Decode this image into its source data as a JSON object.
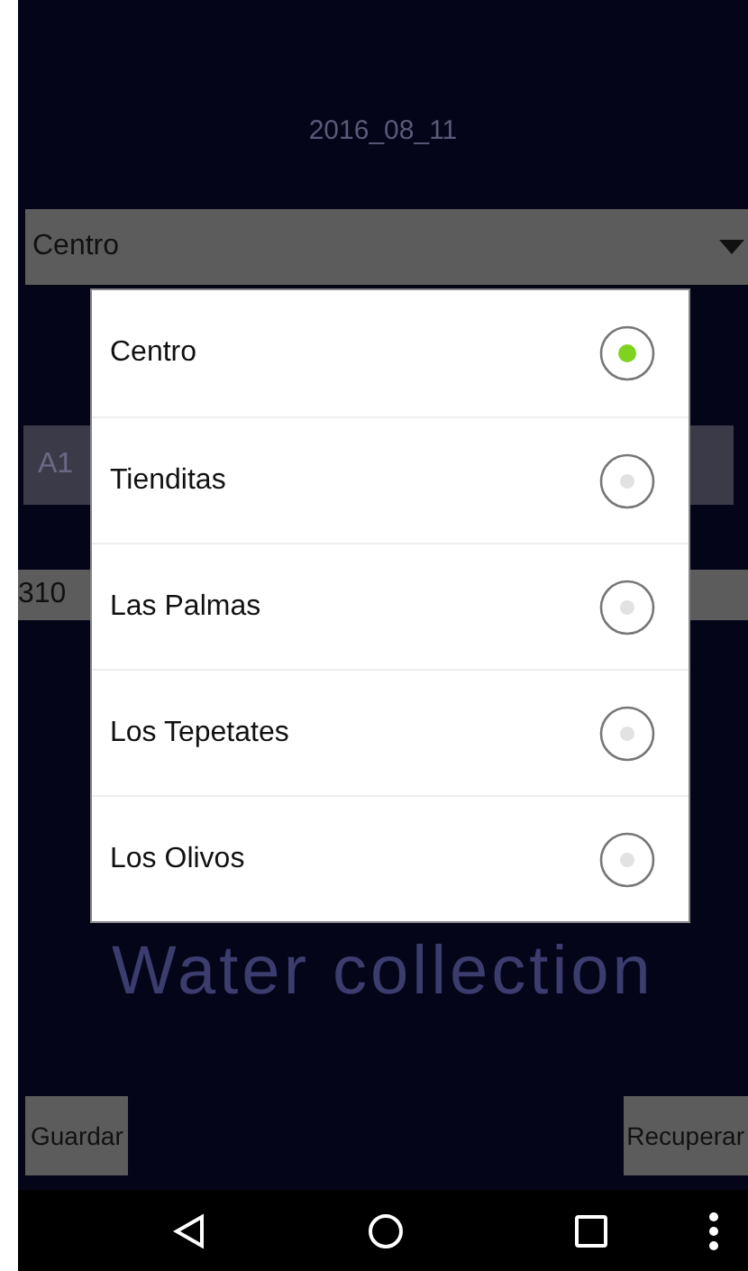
{
  "date": "2016_08_11",
  "spinner": {
    "value": "Centro"
  },
  "field_1": {
    "placeholder": "A1"
  },
  "field_2": {
    "value": "310"
  },
  "title": "Water collection",
  "buttons": [
    "Guardar",
    "Recuperar"
  ],
  "dialog": {
    "options": [
      {
        "label": "Centro",
        "selected": true
      },
      {
        "label": "Tienditas",
        "selected": false
      },
      {
        "label": "Las Palmas",
        "selected": false
      },
      {
        "label": "Los Tepetates",
        "selected": false
      },
      {
        "label": "Los Olivos",
        "selected": false
      }
    ]
  }
}
